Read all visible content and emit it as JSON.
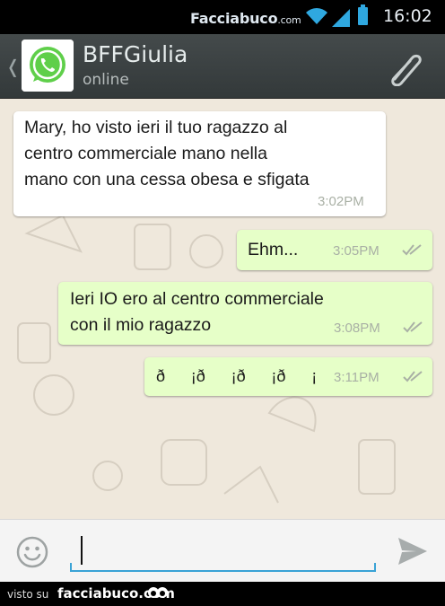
{
  "statusbar": {
    "brand": "Facciabuco",
    "brand_suffix": ".com",
    "time": "16:02",
    "icons": [
      "wifi-icon",
      "signal-icon",
      "battery-icon"
    ],
    "battery_color": "#2fa8e0"
  },
  "header": {
    "back_glyph": "❬",
    "contact_name": "BFFGiulia",
    "contact_status": "online",
    "avatar_icon": "whatsapp-logo-icon",
    "attach_icon": "paperclip-icon"
  },
  "messages": [
    {
      "direction": "in",
      "lines": [
        "Mary, ho visto ieri il tuo ragazzo al",
        "centro commerciale mano nella",
        "mano con una cessa obesa e sfigata"
      ],
      "time": "3:02PM"
    },
    {
      "direction": "out",
      "lines": [
        "Ehm..."
      ],
      "time": "3:05PM",
      "ticks": true
    },
    {
      "direction": "out",
      "lines": [
        "Ieri IO ero al centro commerciale",
        "con il mio ragazzo"
      ],
      "time": "3:08PM",
      "ticks": true
    },
    {
      "direction": "out",
      "lines": [
        "ð¡ð¡ð¡ð¡"
      ],
      "time": "3:11PM",
      "ticks": true
    }
  ],
  "composer": {
    "value": "",
    "smiley_icon": "smiley-icon",
    "send_icon": "send-icon"
  },
  "footer": {
    "visto": "visto su",
    "site": "facciabuco.com"
  },
  "colors": {
    "accent": "#3aa3d6",
    "outgoing_bubble": "#e6ffc8",
    "incoming_bubble": "#ffffff",
    "chat_background": "#efe8dc",
    "header": "#3a3f40"
  }
}
